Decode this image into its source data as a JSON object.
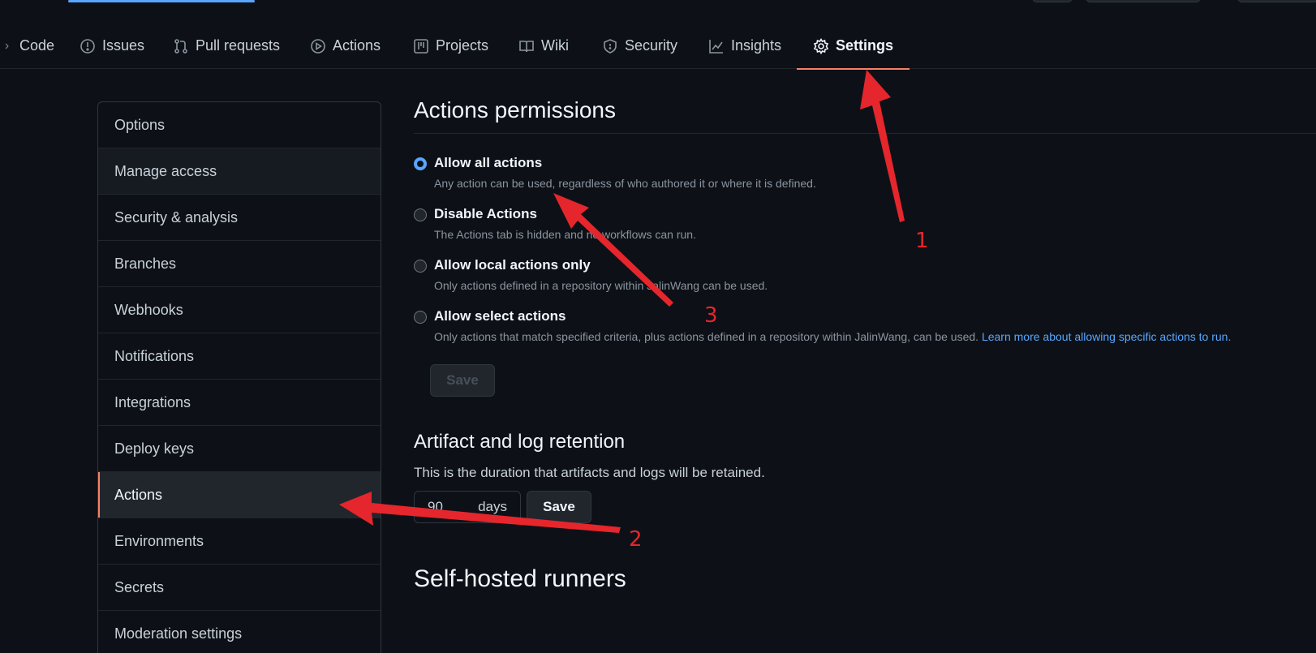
{
  "nav": {
    "tabs": [
      {
        "label": "Code",
        "icon": "chevron-right-icon"
      },
      {
        "label": "Issues",
        "icon": "issue-circle-icon"
      },
      {
        "label": "Pull requests",
        "icon": "pull-request-icon"
      },
      {
        "label": "Actions",
        "icon": "play-circle-icon"
      },
      {
        "label": "Projects",
        "icon": "project-board-icon"
      },
      {
        "label": "Wiki",
        "icon": "book-icon"
      },
      {
        "label": "Security",
        "icon": "shield-icon"
      },
      {
        "label": "Insights",
        "icon": "graph-icon"
      },
      {
        "label": "Settings",
        "icon": "gear-icon",
        "selected": true
      }
    ]
  },
  "sidebar": {
    "items": [
      {
        "label": "Options"
      },
      {
        "label": "Manage access"
      },
      {
        "label": "Security & analysis"
      },
      {
        "label": "Branches"
      },
      {
        "label": "Webhooks"
      },
      {
        "label": "Notifications"
      },
      {
        "label": "Integrations"
      },
      {
        "label": "Deploy keys"
      },
      {
        "label": "Actions",
        "active": true
      },
      {
        "label": "Environments"
      },
      {
        "label": "Secrets"
      },
      {
        "label": "Moderation settings"
      }
    ]
  },
  "permissions": {
    "title": "Actions permissions",
    "options": [
      {
        "label": "Allow all actions",
        "note": "Any action can be used, regardless of who authored it or where it is defined.",
        "checked": true
      },
      {
        "label": "Disable Actions",
        "note": "The Actions tab is hidden and no workflows can run.",
        "checked": false
      },
      {
        "label": "Allow local actions only",
        "note": "Only actions defined in a repository within JalinWang can be used.",
        "checked": false
      },
      {
        "label": "Allow select actions",
        "note": "Only actions that match specified criteria, plus actions defined in a repository within JalinWang, can be used.",
        "link": "Learn more about allowing specific actions to run.",
        "checked": false
      }
    ],
    "save_label": "Save"
  },
  "retention": {
    "title": "Artifact and log retention",
    "description": "This is the duration that artifacts and logs will be retained.",
    "days_value": "90",
    "days_unit": "days",
    "save_label": "Save"
  },
  "runners": {
    "title": "Self-hosted runners"
  },
  "annotations": {
    "color": "#e5262c",
    "labels": [
      "1",
      "2",
      "3"
    ]
  },
  "colors": {
    "background": "#0d1117",
    "accent": "#f78166",
    "link": "#58a6ff"
  }
}
